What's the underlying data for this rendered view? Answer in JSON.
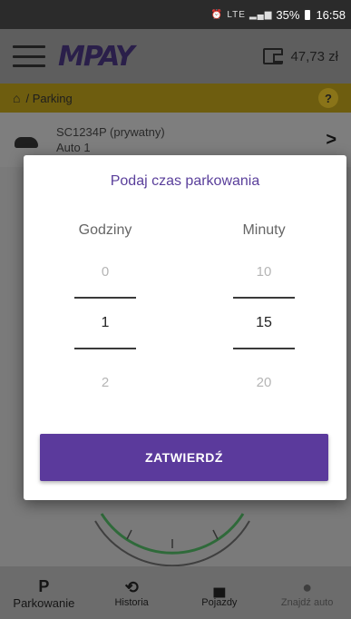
{
  "status_bar": {
    "network": "LTE",
    "battery": "35%",
    "time": "16:58"
  },
  "header": {
    "logo": "MPAY",
    "balance": "47,73 zł"
  },
  "breadcrumb": {
    "path": "/ Parking",
    "help": "?"
  },
  "vehicle": {
    "plate": "SC1234P (prywatny)",
    "name": "Auto 1"
  },
  "dialog": {
    "title": "Podaj czas parkowania",
    "hours": {
      "label": "Godziny",
      "prev": "0",
      "current": "1",
      "next": "2"
    },
    "minutes": {
      "label": "Minuty",
      "prev": "10",
      "current": "15",
      "next": "20"
    },
    "confirm_label": "ZATWIERDŹ"
  },
  "bottom_nav": [
    {
      "glyph": "P",
      "label": "Parkowanie",
      "icon": "parking-icon"
    },
    {
      "glyph": "⟲",
      "label": "Historia",
      "icon": "history-icon"
    },
    {
      "glyph": "▄",
      "label": "Pojazdy",
      "icon": "car-icon"
    },
    {
      "glyph": "●",
      "label": "Znajdź auto",
      "icon": "location-pin-icon"
    }
  ],
  "colors": {
    "accent": "#5b3a9c",
    "breadcrumb_bg": "#e6c41f"
  }
}
